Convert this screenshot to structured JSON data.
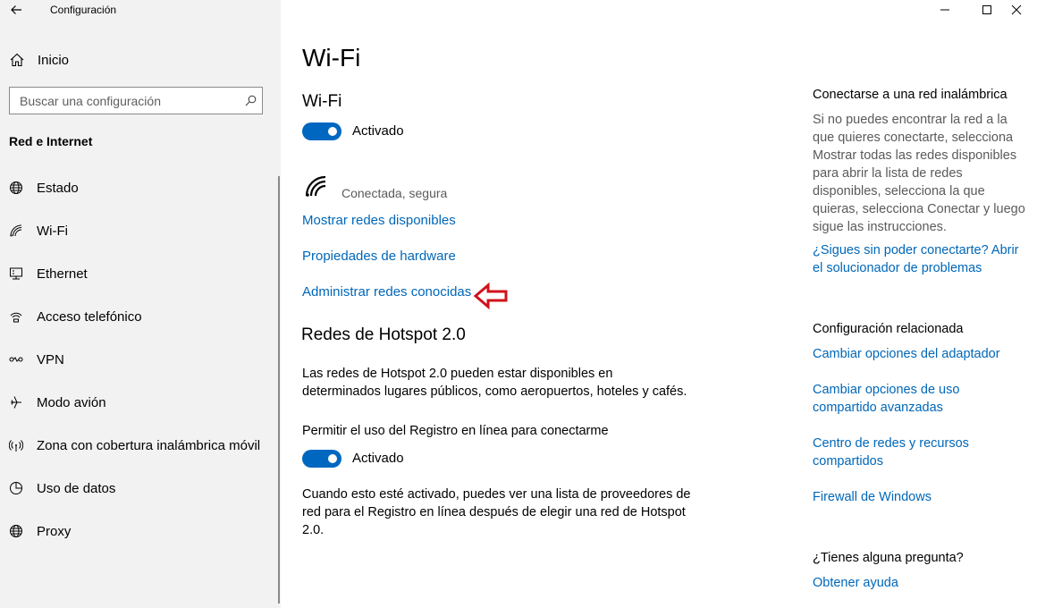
{
  "app": {
    "title": "Configuración"
  },
  "sidebar": {
    "home_label": "Inicio",
    "search_placeholder": "Buscar una configuración",
    "section_title": "Red e Internet",
    "items": [
      {
        "label": "Estado",
        "icon": "globe-icon"
      },
      {
        "label": "Wi-Fi",
        "icon": "wifi-icon"
      },
      {
        "label": "Ethernet",
        "icon": "ethernet-icon"
      },
      {
        "label": "Acceso telefónico",
        "icon": "dialup-icon"
      },
      {
        "label": "VPN",
        "icon": "vpn-icon"
      },
      {
        "label": "Modo avión",
        "icon": "airplane-icon"
      },
      {
        "label": "Zona con cobertura inalámbrica móvil",
        "icon": "hotspot-icon"
      },
      {
        "label": "Uso de datos",
        "icon": "data-usage-icon"
      },
      {
        "label": "Proxy",
        "icon": "globe-icon"
      }
    ]
  },
  "main": {
    "page_title": "Wi-Fi",
    "wifi_section_title": "Wi-Fi",
    "wifi_toggle_label": "Activado",
    "network_status": "Conectada, segura",
    "links": {
      "show_networks": "Mostrar redes disponibles",
      "hardware_properties": "Propiedades de hardware",
      "manage_known": "Administrar redes conocidas"
    },
    "hotspot": {
      "title": "Redes de Hotspot 2.0",
      "desc_line1": "Las redes de Hotspot 2.0 pueden estar disponibles en",
      "desc_line2": "determinados lugares públicos, como aeropuertos, hoteles y cafés.",
      "allow_label": "Permitir el uso del Registro en línea para conectarme",
      "toggle_label": "Activado",
      "note_line1": "Cuando esto esté activado, puedes ver una lista de proveedores de",
      "note_line2": "red para el Registro en línea después de elegir una red de Hotspot",
      "note_line3": "2.0."
    }
  },
  "right": {
    "connect_title": "Conectarse a una red inalámbrica",
    "connect_desc": "Si no puedes encontrar la red a la que quieres conectarte, selecciona Mostrar todas las redes disponibles para abrir la lista de redes disponibles, selecciona la que quieras, selecciona Conectar y luego sigue las instrucciones.",
    "troubleshoot_link": "¿Sigues sin poder conectarte? Abrir el solucionador de problemas",
    "related_title": "Configuración relacionada",
    "related_links": [
      "Cambiar opciones del adaptador",
      "Cambiar opciones de uso compartido avanzadas",
      "Centro de redes y recursos compartidos",
      "Firewall de Windows"
    ],
    "question_title": "¿Tienes alguna pregunta?",
    "help_link": "Obtener ayuda"
  },
  "colors": {
    "accent": "#0067c0",
    "link": "#0067b8",
    "annotation_arrow": "#d0121b",
    "sidebar_bg": "#f2f2f2"
  }
}
